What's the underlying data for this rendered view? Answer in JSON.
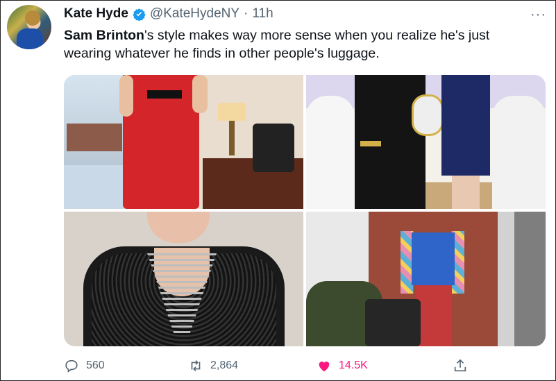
{
  "tweet": {
    "author_name": "Kate Hyde",
    "handle": "@KateHydeNY",
    "separator": "·",
    "time": "11h",
    "more": "···",
    "text_bold": "Sam Brinton",
    "text_rest": "'s style makes way more sense when you realize he's just wearing whatever he finds in other people's luggage."
  },
  "actions": {
    "replies": "560",
    "retweets": "2,864",
    "likes": "14.5K"
  },
  "colors": {
    "verified": "#1d9bf0",
    "like_active": "#f91880",
    "secondary_text": "#536471"
  },
  "icons": [
    "verified-icon",
    "more-icon",
    "reply-icon",
    "retweet-icon",
    "like-icon",
    "share-icon"
  ]
}
